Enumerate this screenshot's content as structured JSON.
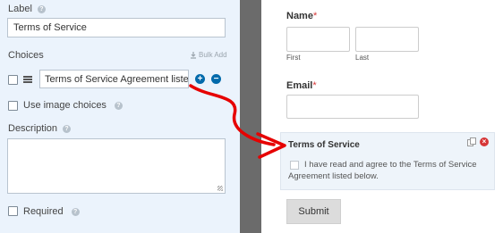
{
  "field_options": {
    "label": {
      "title": "Label",
      "value": "Terms of Service"
    },
    "choices": {
      "title": "Choices",
      "bulk_add": "Bulk Add",
      "items": [
        {
          "value": "Terms of Service Agreement listed bel"
        }
      ]
    },
    "image_choices": {
      "label": "Use image choices"
    },
    "description": {
      "title": "Description",
      "value": ""
    },
    "required": {
      "label": "Required"
    }
  },
  "form_preview": {
    "name": {
      "label": "Name",
      "required_mark": "*",
      "sublabels": {
        "first": "First",
        "last": "Last"
      }
    },
    "email": {
      "label": "Email",
      "required_mark": "*"
    },
    "terms": {
      "title": "Terms of Service",
      "text": "I have read and agree to the Terms of Service Agreement listed below."
    },
    "submit": "Submit"
  },
  "colors": {
    "left_panel_bg": "#ebf3fc",
    "divider": "#6b6b6b",
    "arrow": "#e60000",
    "accent_blue": "#036aab",
    "required_red": "#d63637"
  }
}
